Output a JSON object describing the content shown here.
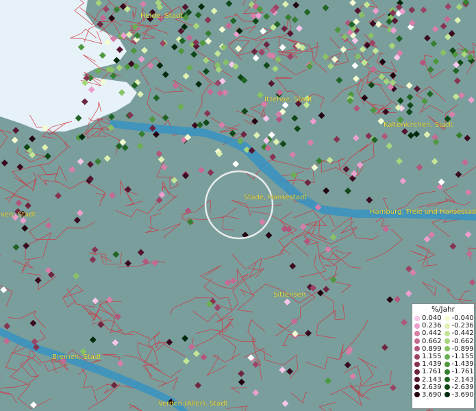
{
  "map": {
    "places": [
      {
        "name": "Heide, Stadt"
      },
      {
        "name": "Itzehoe, Stadt"
      },
      {
        "name": "Kaltenkirchen, Stadt"
      },
      {
        "name": "Stade, Hansestadt"
      },
      {
        "name": "Hamburg, Freie und Hansestadt"
      },
      {
        "name": "ven, Stadt"
      },
      {
        "name": "Sittensen"
      },
      {
        "name": "Bremen, Stadt"
      },
      {
        "name": "Verden (Aller), Stadt"
      }
    ],
    "colors": {
      "land": "#7a9e9c",
      "sea": "#e6f2f7",
      "river": "#3b92c0",
      "boundary": "#d2333d",
      "label": "#f2e24a",
      "highlight_ring": "#f5f5f5"
    }
  },
  "legend": {
    "title": "%/Jahr",
    "positive": [
      {
        "value": "0.040",
        "color": "#f7c6e9"
      },
      {
        "value": "0.236",
        "color": "#ec9fce"
      },
      {
        "value": "0.442",
        "color": "#d77fa9"
      },
      {
        "value": "0.662",
        "color": "#c56a92"
      },
      {
        "value": "0.899",
        "color": "#b2567c"
      },
      {
        "value": "1.155",
        "color": "#9c4466"
      },
      {
        "value": "1.439",
        "color": "#863451"
      },
      {
        "value": "1.761",
        "color": "#6e2640"
      },
      {
        "value": "2.143",
        "color": "#551730"
      },
      {
        "value": "2.639",
        "color": "#3a0b1f"
      },
      {
        "value": "3.690",
        "color": "#220310"
      }
    ],
    "negative": [
      {
        "value": "-0.040",
        "color": "#f4fbd0"
      },
      {
        "value": "-0.236",
        "color": "#dff1b2"
      },
      {
        "value": "-0.442",
        "color": "#c4e596"
      },
      {
        "value": "-0.662",
        "color": "#a7d57c"
      },
      {
        "value": "-0.899",
        "color": "#89c266"
      },
      {
        "value": "-1.155",
        "color": "#6caf53"
      },
      {
        "value": "-1.439",
        "color": "#4f9840"
      },
      {
        "value": "-1.761",
        "color": "#377f31"
      },
      {
        "value": "-2.143",
        "color": "#216425"
      },
      {
        "value": "-2.639",
        "color": "#104818"
      },
      {
        "value": "-3.690",
        "color": "#03290c"
      }
    ]
  }
}
